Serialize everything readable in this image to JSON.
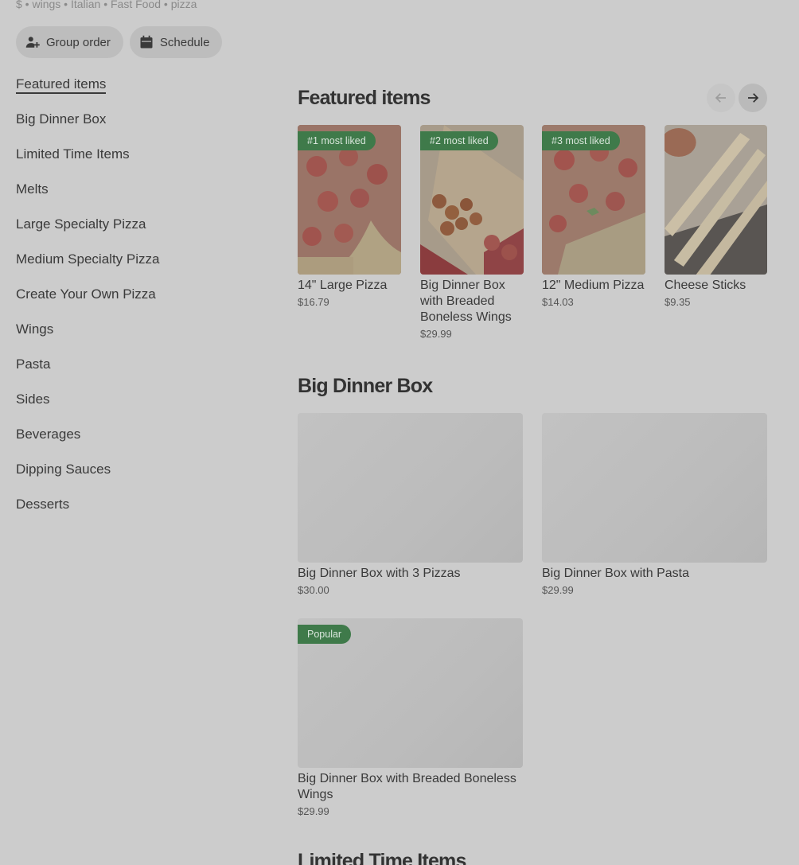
{
  "store": {
    "tagline": "$ • wings • Italian • Fast Food • pizza"
  },
  "actions": {
    "group_order": "Group order",
    "schedule": "Schedule"
  },
  "menu": {
    "items": [
      {
        "label": "Featured items"
      },
      {
        "label": "Big Dinner Box"
      },
      {
        "label": "Limited Time Items"
      },
      {
        "label": "Melts"
      },
      {
        "label": "Large Specialty Pizza"
      },
      {
        "label": "Medium Specialty Pizza"
      },
      {
        "label": "Create Your Own Pizza"
      },
      {
        "label": "Wings"
      },
      {
        "label": "Pasta"
      },
      {
        "label": "Sides"
      },
      {
        "label": "Beverages"
      },
      {
        "label": "Dipping Sauces"
      },
      {
        "label": "Desserts"
      }
    ],
    "active": "Featured items"
  },
  "featured": {
    "title": "Featured items",
    "items": [
      {
        "badge": "#1 most liked",
        "name": "14\" Large Pizza",
        "price": "$16.79"
      },
      {
        "badge": "#2 most liked",
        "name": "Big Dinner Box with Breaded Boneless Wings",
        "price": "$29.99"
      },
      {
        "badge": "#3 most liked",
        "name": "12\" Medium Pizza",
        "price": "$14.03"
      },
      {
        "name": "Cheese Sticks",
        "price": "$9.35"
      }
    ]
  },
  "big_dinner_box": {
    "title": "Big Dinner Box",
    "items": [
      {
        "name": "Big Dinner Box with 3 Pizzas",
        "price": "$30.00"
      },
      {
        "name": "Big Dinner Box with Pasta",
        "price": "$29.99"
      },
      {
        "badge": "Popular",
        "name": "Big Dinner Box with Breaded Boneless Wings",
        "price": "$29.99"
      }
    ]
  },
  "limited_time": {
    "title": "Limited Time Items"
  },
  "icons": {
    "group": "person-add-icon",
    "schedule": "calendar-icon",
    "prev": "arrow-left-icon",
    "next": "arrow-right-icon"
  },
  "colors": {
    "badge": "#3f7a4a",
    "overlay": "#cccccc"
  }
}
